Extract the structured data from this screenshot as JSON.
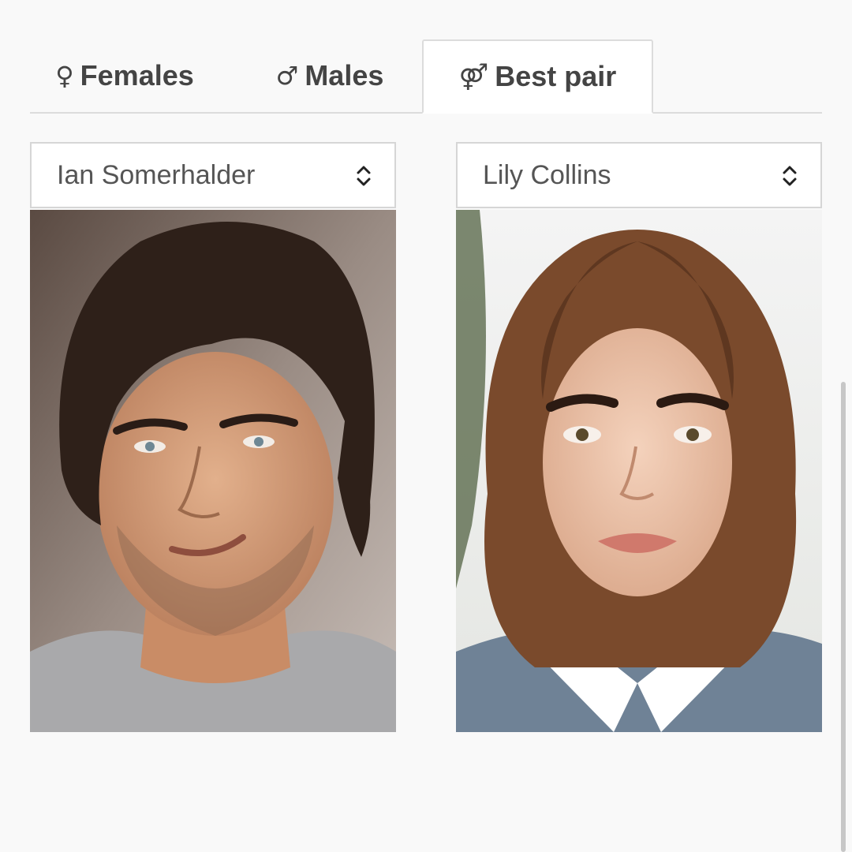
{
  "tabs": [
    {
      "label": "Females",
      "icon": "female-symbol-icon",
      "glyph": "♀",
      "active": false
    },
    {
      "label": "Males",
      "icon": "male-symbol-icon",
      "glyph": "♂",
      "active": false
    },
    {
      "label": "Best pair",
      "icon": "female-male-symbol-icon",
      "glyph": "⚤",
      "active": true
    }
  ],
  "selectors": {
    "left": {
      "value": "Ian Somerhalder",
      "icon": "up-down-chevron-icon"
    },
    "right": {
      "value": "Lily Collins",
      "icon": "up-down-chevron-icon"
    }
  },
  "photos": {
    "left": {
      "subject": "Ian Somerhalder"
    },
    "right": {
      "subject": "Lily Collins"
    }
  }
}
